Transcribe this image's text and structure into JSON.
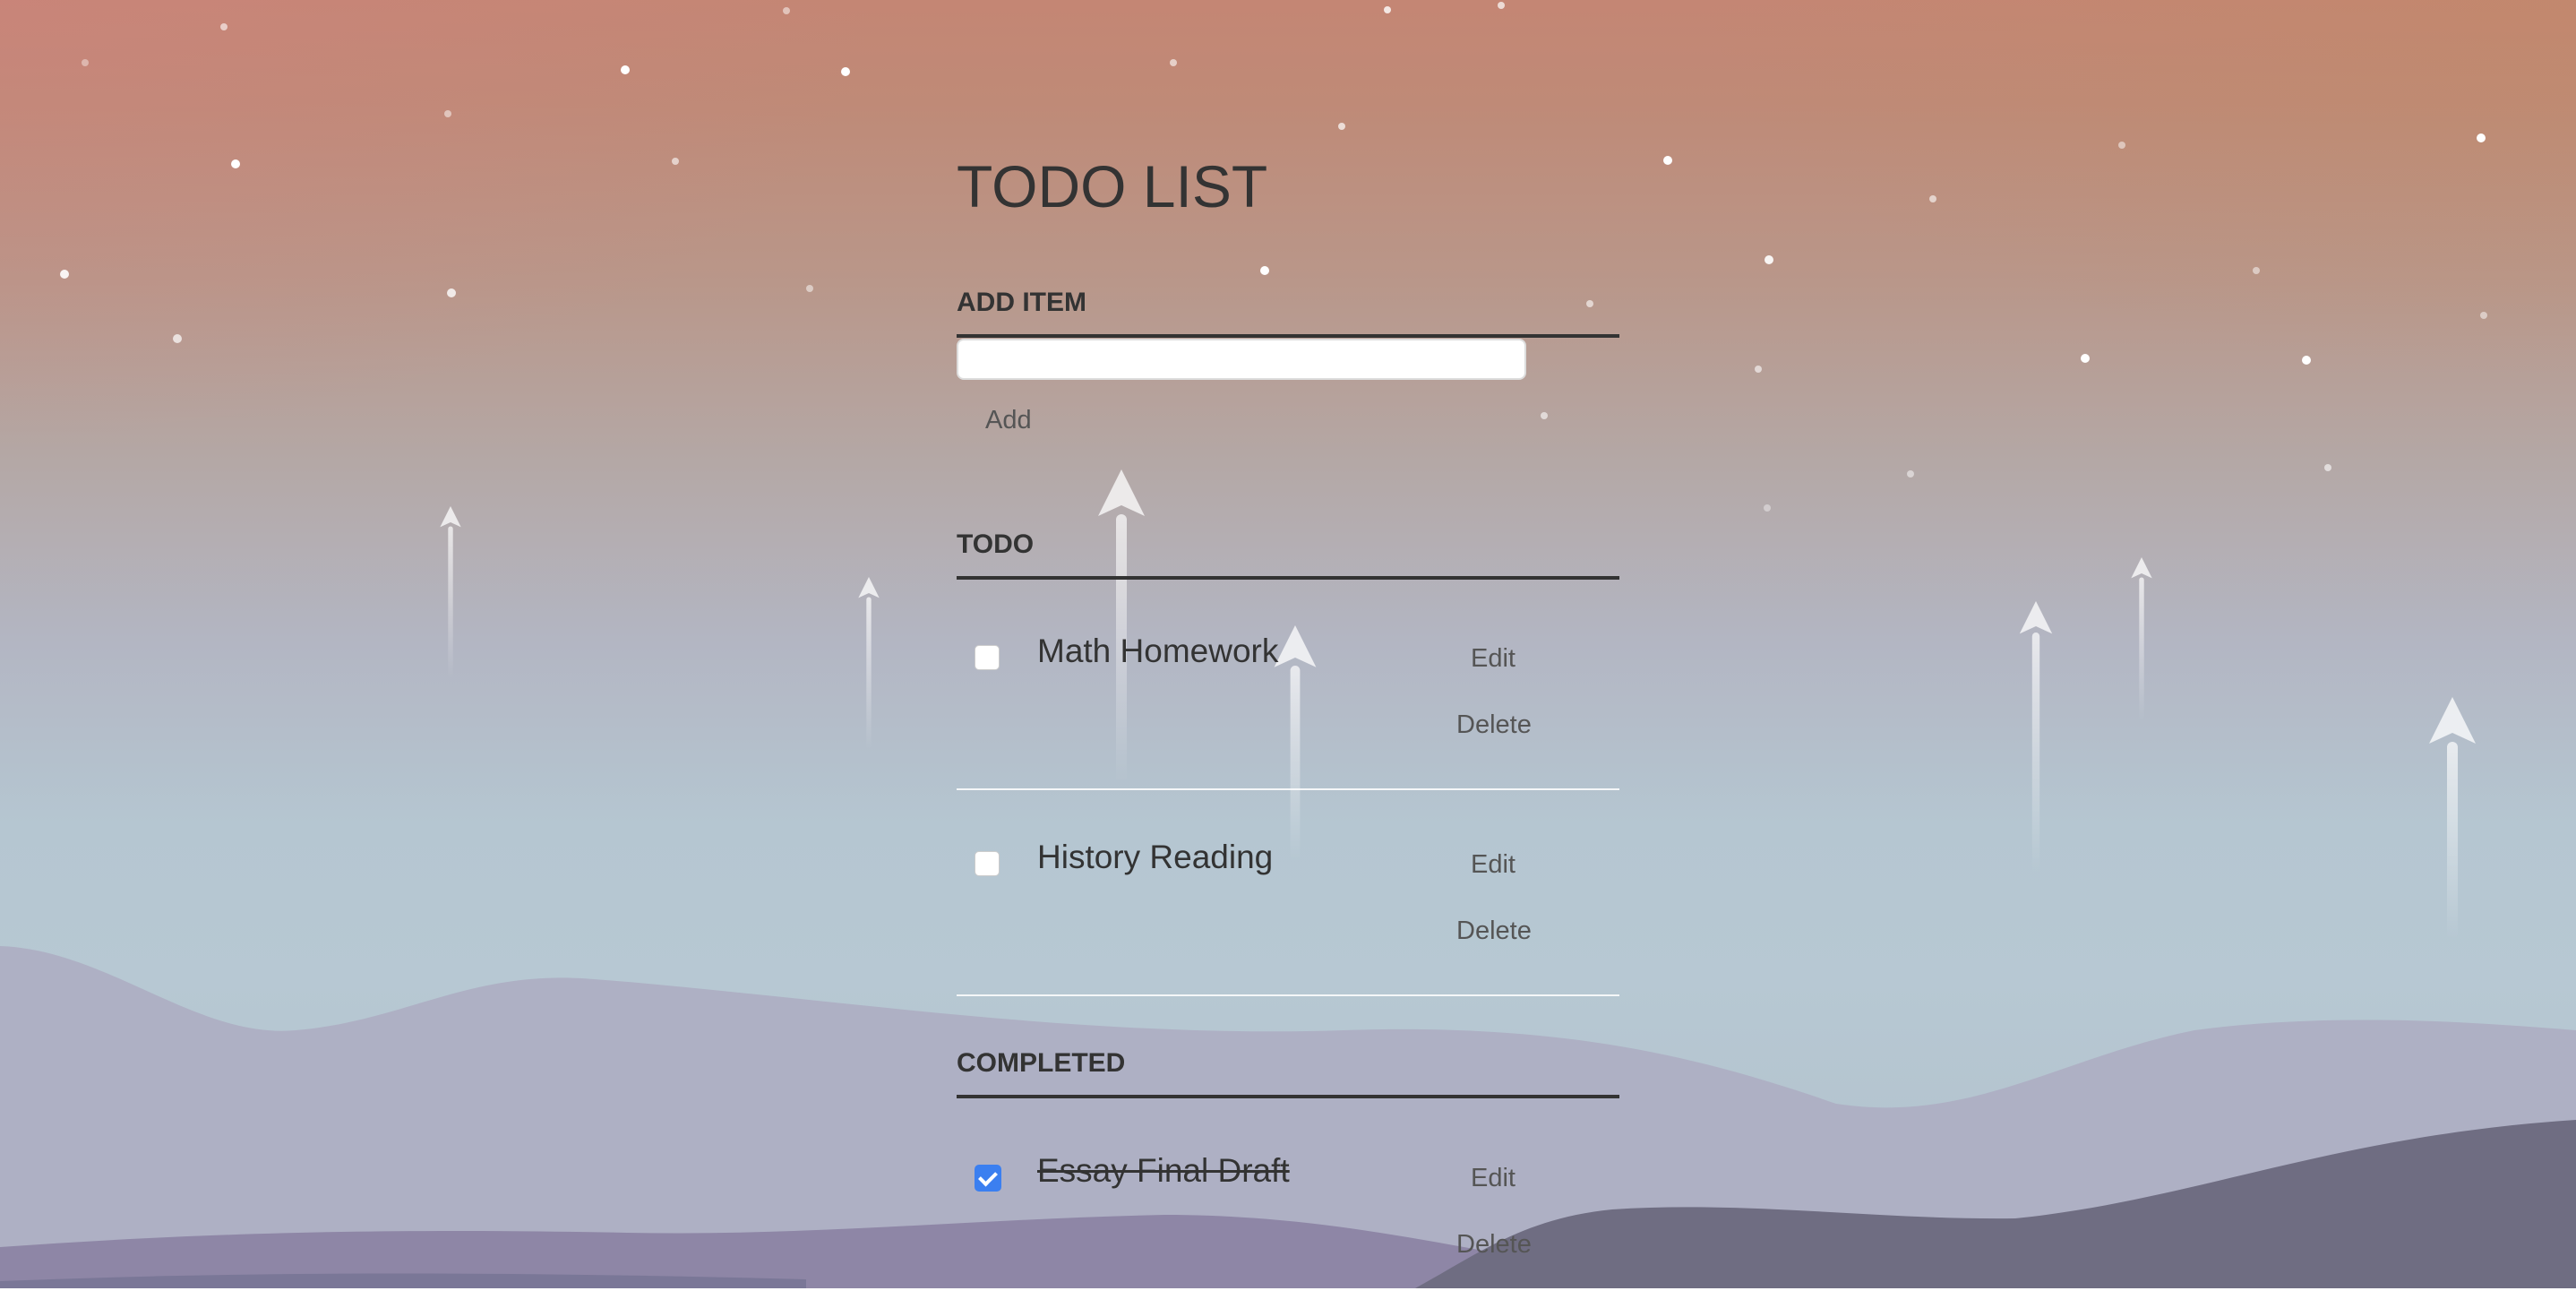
{
  "app": {
    "title": "TODO LIST"
  },
  "add_section": {
    "heading": "ADD ITEM",
    "input_value": "",
    "add_label": "Add"
  },
  "todo_section": {
    "heading": "TODO",
    "items": [
      {
        "label": "Math Homework",
        "checked": false,
        "edit_label": "Edit",
        "delete_label": "Delete"
      },
      {
        "label": "History Reading",
        "checked": false,
        "edit_label": "Edit",
        "delete_label": "Delete"
      }
    ]
  },
  "completed_section": {
    "heading": "COMPLETED",
    "items": [
      {
        "label": "Essay Final Draft",
        "checked": true,
        "edit_label": "Edit",
        "delete_label": "Delete"
      }
    ]
  },
  "colors": {
    "text": "#333333",
    "button_text": "#555555",
    "checkbox_checked": "#3b7ff0",
    "sky_top": "#c48674",
    "sky_bottom": "#b7c8d3",
    "hill_light": "#aeb0c4",
    "hill_purple": "#8c83a4",
    "hill_dark": "#6b6a7e"
  },
  "icons": {
    "background_rocket": "rocket-icon",
    "checkbox_check": "check-icon"
  }
}
